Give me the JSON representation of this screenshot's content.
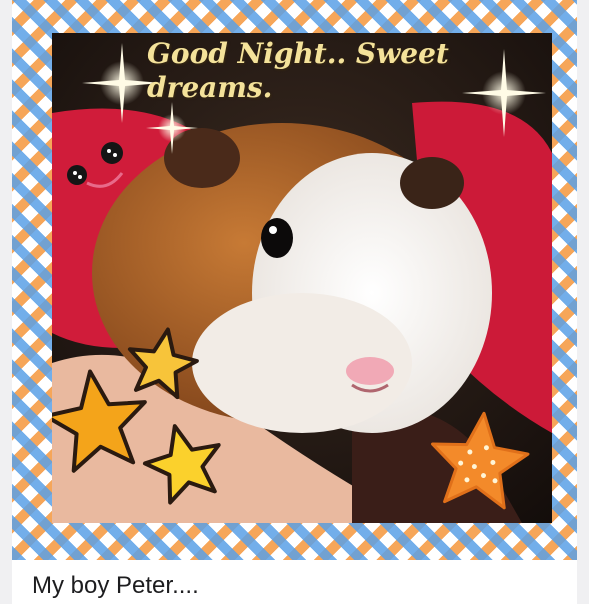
{
  "post": {
    "image_overlay_text": "Good Night.. Sweet dreams.",
    "caption": "My boy Peter...."
  },
  "colors": {
    "frame_blue": "#5aa0e6",
    "frame_orange": "#f5963c",
    "overlay_text": "#f4e29a",
    "caption_text": "#1d1d1f"
  },
  "icons": [
    "sparkle-icon",
    "star-icon",
    "ladybug-sticker-icon",
    "cookie-star-icon"
  ]
}
